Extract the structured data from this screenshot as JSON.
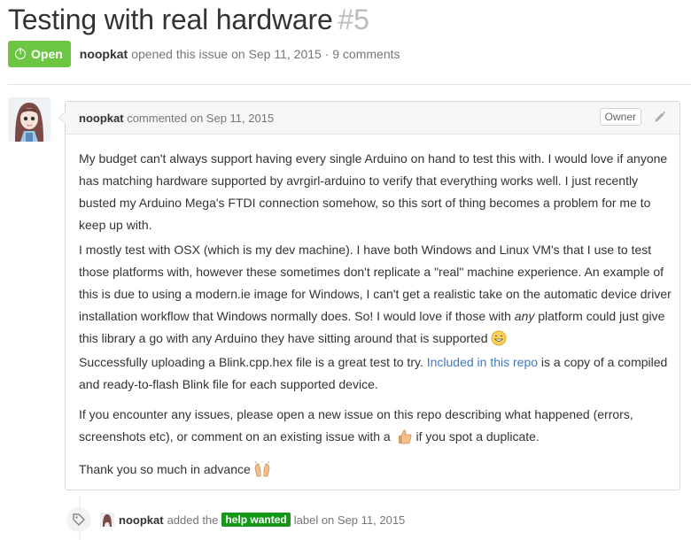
{
  "issue": {
    "title": "Testing with real hardware",
    "number": "#5",
    "state": "Open",
    "author": "noopkat",
    "opened_text": "opened this issue on Sep 11, 2015 · 9 comments"
  },
  "comment": {
    "author": "noopkat",
    "commented_text": "commented on Sep 11, 2015",
    "badge": "Owner",
    "p1": "My budget can't always support having every single Arduino on hand to test this with. I would love if anyone has matching hardware supported by avrgirl-arduino to verify that everything works well. I just recently busted my Arduino Mega's FTDI connection somehow, so this sort of thing becomes a problem for me to keep up with.",
    "p2a": "I mostly test with OSX (which is my dev machine). I have both Windows and Linux VM's that I use to test those platforms with, however these sometimes don't replicate a \"real\" machine experience. An example of this is due to using a modern.ie image for Windows, I can't get a realistic take on the automatic device driver installation workflow that Windows normally does. So! I would love if those with ",
    "p2em": "any",
    "p2b": " platform could just give this library a go with any Arduino they have sitting around that is supported",
    "p3a": "Successfully uploading a Blink.cpp.hex file is a great test to try. ",
    "p3link": "Included in this repo",
    "p3b": " is a copy of a compiled and ready-to-flash Blink file for each supported device.",
    "p4a": "If you encounter any issues, please open a new issue on this repo describing what happened (errors, screenshots etc), or comment on an existing issue with a ",
    "p4b": " if you spot a duplicate.",
    "p5": "Thank you so much in advance"
  },
  "event": {
    "author": "noopkat",
    "pre": "added the",
    "label": "help wanted",
    "post": "label on Sep 11, 2015"
  },
  "colors": {
    "open": "#6cc644",
    "link": "#4078c0",
    "label": "#159818"
  }
}
